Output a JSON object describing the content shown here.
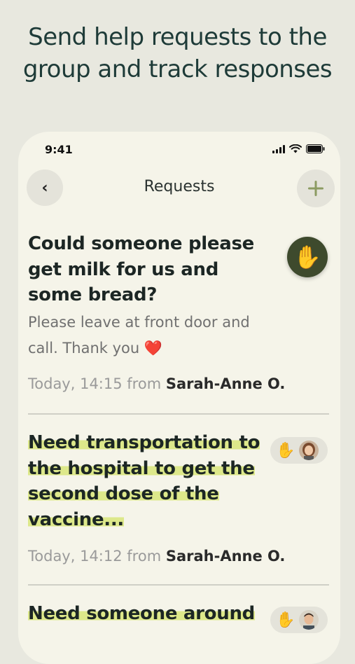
{
  "headline": "Send help requests to the group and track responses",
  "status_bar": {
    "time": "9:41"
  },
  "nav": {
    "back_icon": "‹",
    "title": "Requests",
    "add_icon": "+"
  },
  "requests": [
    {
      "title": "Could someone please get milk for us and some bread?",
      "description": "Please leave at front door and call. Thank you ❤️",
      "meta_prefix": "Today, 14:15 from ",
      "author": "Sarah-Anne O.",
      "icon": "raised-hand-icon"
    },
    {
      "title": "Need transportation to the hospital to get the second dose of the vaccine...",
      "meta_prefix": "Today, 14:12 from ",
      "author": "Sarah-Anne O.",
      "icon": "raised-hand-icon"
    },
    {
      "title": "Need someone around",
      "icon": "raised-hand-icon"
    }
  ],
  "colors": {
    "background": "#e8e8df",
    "card": "#f5f4e9",
    "accent_dark": "#3e4a2d",
    "highlight": "#dde88a"
  }
}
